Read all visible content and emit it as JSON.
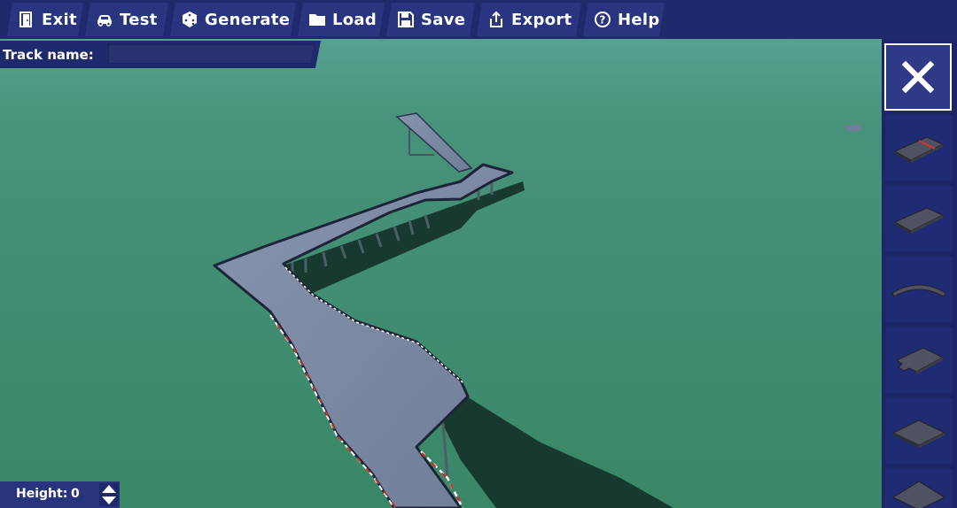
{
  "toolbar": {
    "buttons": [
      {
        "label": "Exit",
        "icon": "door-exit-icon"
      },
      {
        "label": "Test",
        "icon": "car-icon"
      },
      {
        "label": "Generate",
        "icon": "dice-icon"
      },
      {
        "label": "Load",
        "icon": "folder-icon"
      },
      {
        "label": "Save",
        "icon": "floppy-disk-icon"
      },
      {
        "label": "Export",
        "icon": "share-export-icon"
      },
      {
        "label": "Help",
        "icon": "help-circle-icon"
      }
    ]
  },
  "track": {
    "label": "Track name:",
    "value": "",
    "placeholder": ""
  },
  "palette": {
    "close_icon": "close-x-icon",
    "pieces": [
      {
        "name": "start-finish-piece"
      },
      {
        "name": "straight-piece"
      },
      {
        "name": "curve-piece"
      },
      {
        "name": "corner-piece"
      },
      {
        "name": "flat-tile-piece"
      },
      {
        "name": "ramp-piece"
      }
    ]
  },
  "height": {
    "label": "Height:",
    "value": "0"
  },
  "colors": {
    "toolbar_bg": "#1f2a6c",
    "button_bg": "#2a3580",
    "ground": "#3b8a69",
    "track_surface": "#7c8aa3",
    "shadow": "#17392f"
  }
}
